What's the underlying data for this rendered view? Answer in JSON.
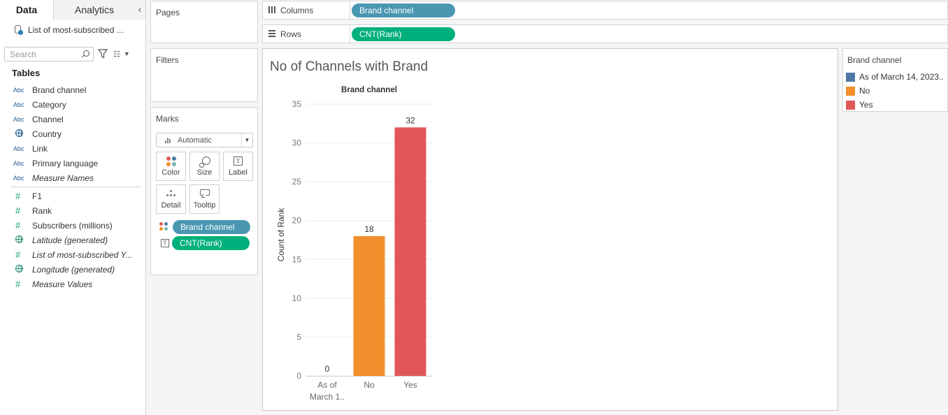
{
  "data_pane": {
    "tabs": [
      {
        "label": "Data"
      },
      {
        "label": "Analytics"
      }
    ],
    "collapse_glyph": "‹",
    "datasource_label": "List of most-subscribed ...",
    "search_placeholder": "Search",
    "tables_header": "Tables",
    "dimensions": [
      {
        "label": "Brand channel",
        "type_icon": "Abc"
      },
      {
        "label": "Category",
        "type_icon": "Abc"
      },
      {
        "label": "Channel",
        "type_icon": "Abc"
      },
      {
        "label": "Country",
        "type_icon": "globe-icon"
      },
      {
        "label": "Link",
        "type_icon": "Abc"
      },
      {
        "label": "Primary language",
        "type_icon": "Abc"
      },
      {
        "label": "Measure Names",
        "type_icon": "Abc"
      }
    ],
    "measures": [
      {
        "label": "F1",
        "type_icon": "#"
      },
      {
        "label": "Rank",
        "type_icon": "#"
      },
      {
        "label": "Subscribers (millions)",
        "type_icon": "#"
      },
      {
        "label": "Latitude (generated)",
        "type_icon": "globe-icon"
      },
      {
        "label": "List of most-subscribed Y...",
        "type_icon": "#"
      },
      {
        "label": "Longitude (generated)",
        "type_icon": "globe-icon"
      },
      {
        "label": "Measure Values",
        "type_icon": "#"
      }
    ]
  },
  "cards": {
    "pages_title": "Pages",
    "filters_title": "Filters",
    "marks_title": "Marks",
    "mark_type": "Automatic",
    "mark_buttons": {
      "color": "Color",
      "size": "Size",
      "label": "Label",
      "detail": "Detail",
      "tooltip": "Tooltip"
    },
    "marks_pills": [
      {
        "label": "Brand channel",
        "encoding": "color"
      },
      {
        "label": "CNT(Rank)",
        "encoding": "label"
      }
    ]
  },
  "shelves": {
    "columns_label": "Columns",
    "columns_pill": "Brand channel",
    "rows_label": "Rows",
    "rows_pill": "CNT(Rank)"
  },
  "colors": {
    "dimension_pill": "#4a97b2",
    "measure_pill": "#00b07c"
  },
  "legend": {
    "title": "Brand channel",
    "items": [
      {
        "label": "As of March 14, 2023..",
        "color": "#4e79a7"
      },
      {
        "label": "No",
        "color": "#f28e2b"
      },
      {
        "label": "Yes",
        "color": "#e15759"
      }
    ]
  },
  "viz": {
    "title": "No of Channels with Brand"
  },
  "chart_data": {
    "type": "bar",
    "title": "No of Channels with Brand",
    "column_header": "Brand channel",
    "xlabel": "",
    "ylabel": "Count of Rank",
    "categories": [
      "As of March 1..",
      "No",
      "Yes"
    ],
    "category_lines": [
      [
        "As of",
        "March 1.."
      ],
      [
        "No"
      ],
      [
        "Yes"
      ]
    ],
    "values": [
      0,
      18,
      32
    ],
    "data_labels": [
      "0",
      "18",
      "32"
    ],
    "colors": [
      "#4e79a7",
      "#f28e2b",
      "#e15759"
    ],
    "ylim": [
      0,
      35
    ],
    "yticks": [
      0,
      5,
      10,
      15,
      20,
      25,
      30,
      35
    ],
    "grid": true
  }
}
